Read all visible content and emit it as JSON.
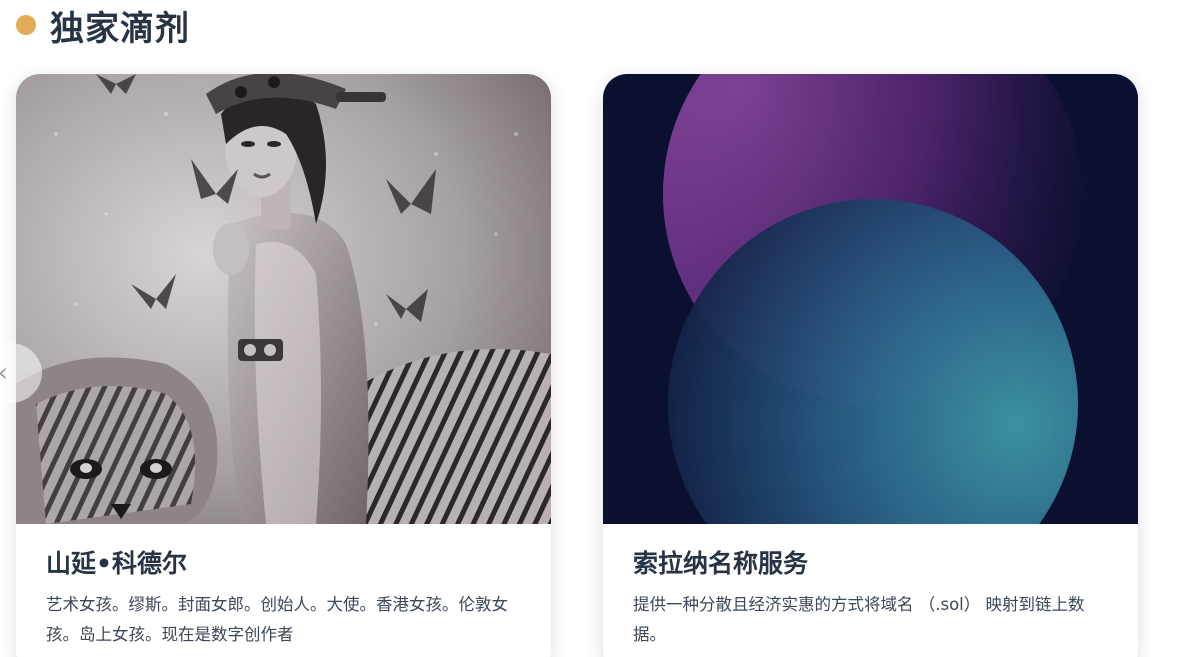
{
  "section": {
    "title": "独家滴剂"
  },
  "cards": [
    {
      "title": "山延•科德尔",
      "description": "艺术女孩。缪斯。封面女郎。创始人。大使。香港女孩。伦敦女孩。岛上女孩。现在是数字创作者",
      "image_icon": "pencil-drawing-woman-with-tiger"
    },
    {
      "title": "索拉纳名称服务",
      "description": "提供一种分散且经济实惠的方式将域名 （.sol） 映射到链上数据。",
      "image_icon": "gradient-spheres-artwork"
    }
  ],
  "carousel": {
    "prev_icon": "chevron-left-icon"
  },
  "colors": {
    "accent_dot": "#e2ab55",
    "title_text": "#273445",
    "body_text": "#3c4757",
    "card2_background": "#0b1030"
  }
}
